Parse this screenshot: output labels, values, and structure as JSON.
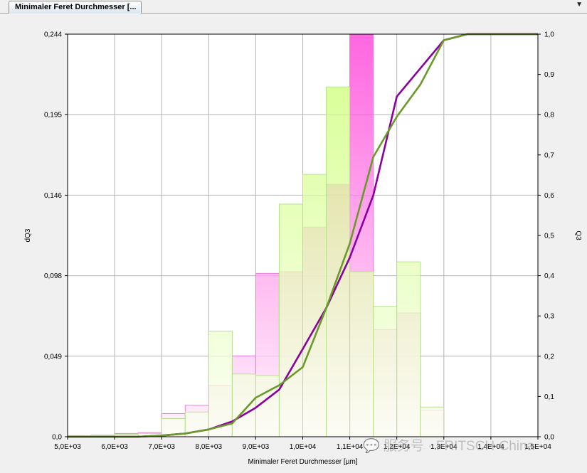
{
  "tab": {
    "title": "Minimaler Feret Durchmesser [...",
    "menu_icon": "dropdown-arrow-icon"
  },
  "watermark": "💬 服务号 · FRITSCH-China",
  "chart_data": {
    "type": "bar",
    "xlabel": "Minimaler Feret Durchmesser [µm]",
    "ylabel": "dQ3",
    "y2label": "Q3",
    "xlim": [
      5000,
      15000
    ],
    "ylim": [
      0,
      0.244
    ],
    "y2lim": [
      0,
      1
    ],
    "x_ticks": [
      "5,0E+03",
      "6,0E+03",
      "7,0E+03",
      "8,0E+03",
      "9,0E+03",
      "1,0E+04",
      "1,1E+04",
      "1,2E+04",
      "1,3E+04",
      "1,4E+04",
      "1,5E+04"
    ],
    "y_ticks": [
      "0,0",
      "0,049",
      "0,098",
      "0,146",
      "0,195",
      "0,244"
    ],
    "y2_ticks": [
      "0,0",
      "0,1",
      "0,2",
      "0,3",
      "0,4",
      "0,5",
      "0,6",
      "0,7",
      "0,8",
      "0,9",
      "1,0"
    ],
    "grid": true,
    "bin_width": 500,
    "series": [
      {
        "color_top": "#ff33d6",
        "color_bottom": "#fff0fc",
        "edge": "#e880d8",
        "x": [
          5500,
          6000,
          6500,
          7000,
          7500,
          8000,
          8500,
          9000,
          9500,
          10000,
          10500,
          11000,
          11500,
          12000,
          12500,
          13000,
          13500
        ],
        "values": [
          0.0005,
          0.001,
          0.002,
          0.0025,
          0.014,
          0.019,
          0.031,
          0.049,
          0.099,
          0.1,
          0.127,
          0.153,
          0.244,
          0.065,
          0.075,
          0.016,
          0.0
        ]
      },
      {
        "color_top": "#c8ff66",
        "color_bottom": "#fbfff3",
        "edge": "#b8e090",
        "x": [
          5500,
          6000,
          6500,
          7000,
          7500,
          8000,
          8500,
          9000,
          9500,
          10000,
          10500,
          11000,
          11500,
          12000,
          12500,
          13000,
          13500
        ],
        "values": [
          0.0005,
          0.001,
          0.0015,
          0.002,
          0.011,
          0.015,
          0.064,
          0.038,
          0.037,
          0.141,
          0.159,
          0.212,
          0.1,
          0.079,
          0.106,
          0.018,
          0.0
        ]
      },
      {
        "type": "line",
        "axis": "right",
        "color": "#8b00a0",
        "x": [
          5000,
          5500,
          6000,
          6500,
          7000,
          7500,
          8000,
          8500,
          9000,
          9500,
          10000,
          10500,
          11000,
          11500,
          12000,
          12500,
          13000,
          13500,
          14000,
          14500,
          15000
        ],
        "values": [
          0,
          0,
          0,
          0,
          0.003,
          0.008,
          0.018,
          0.038,
          0.072,
          0.117,
          0.218,
          0.32,
          0.445,
          0.6,
          0.845,
          0.915,
          0.985,
          1.0,
          1.0,
          1.0,
          1.0
        ]
      },
      {
        "type": "line",
        "axis": "right",
        "color": "#6a9a2a",
        "x": [
          5000,
          5500,
          6000,
          6500,
          7000,
          7500,
          8000,
          8500,
          9000,
          9500,
          10000,
          10500,
          11000,
          11500,
          12000,
          12500,
          13000,
          13500,
          14000,
          14500,
          15000
        ],
        "values": [
          0,
          0,
          0,
          0,
          0.003,
          0.008,
          0.018,
          0.033,
          0.097,
          0.128,
          0.173,
          0.32,
          0.48,
          0.695,
          0.795,
          0.875,
          0.985,
          1.0,
          1.0,
          1.0,
          1.0
        ]
      }
    ]
  }
}
